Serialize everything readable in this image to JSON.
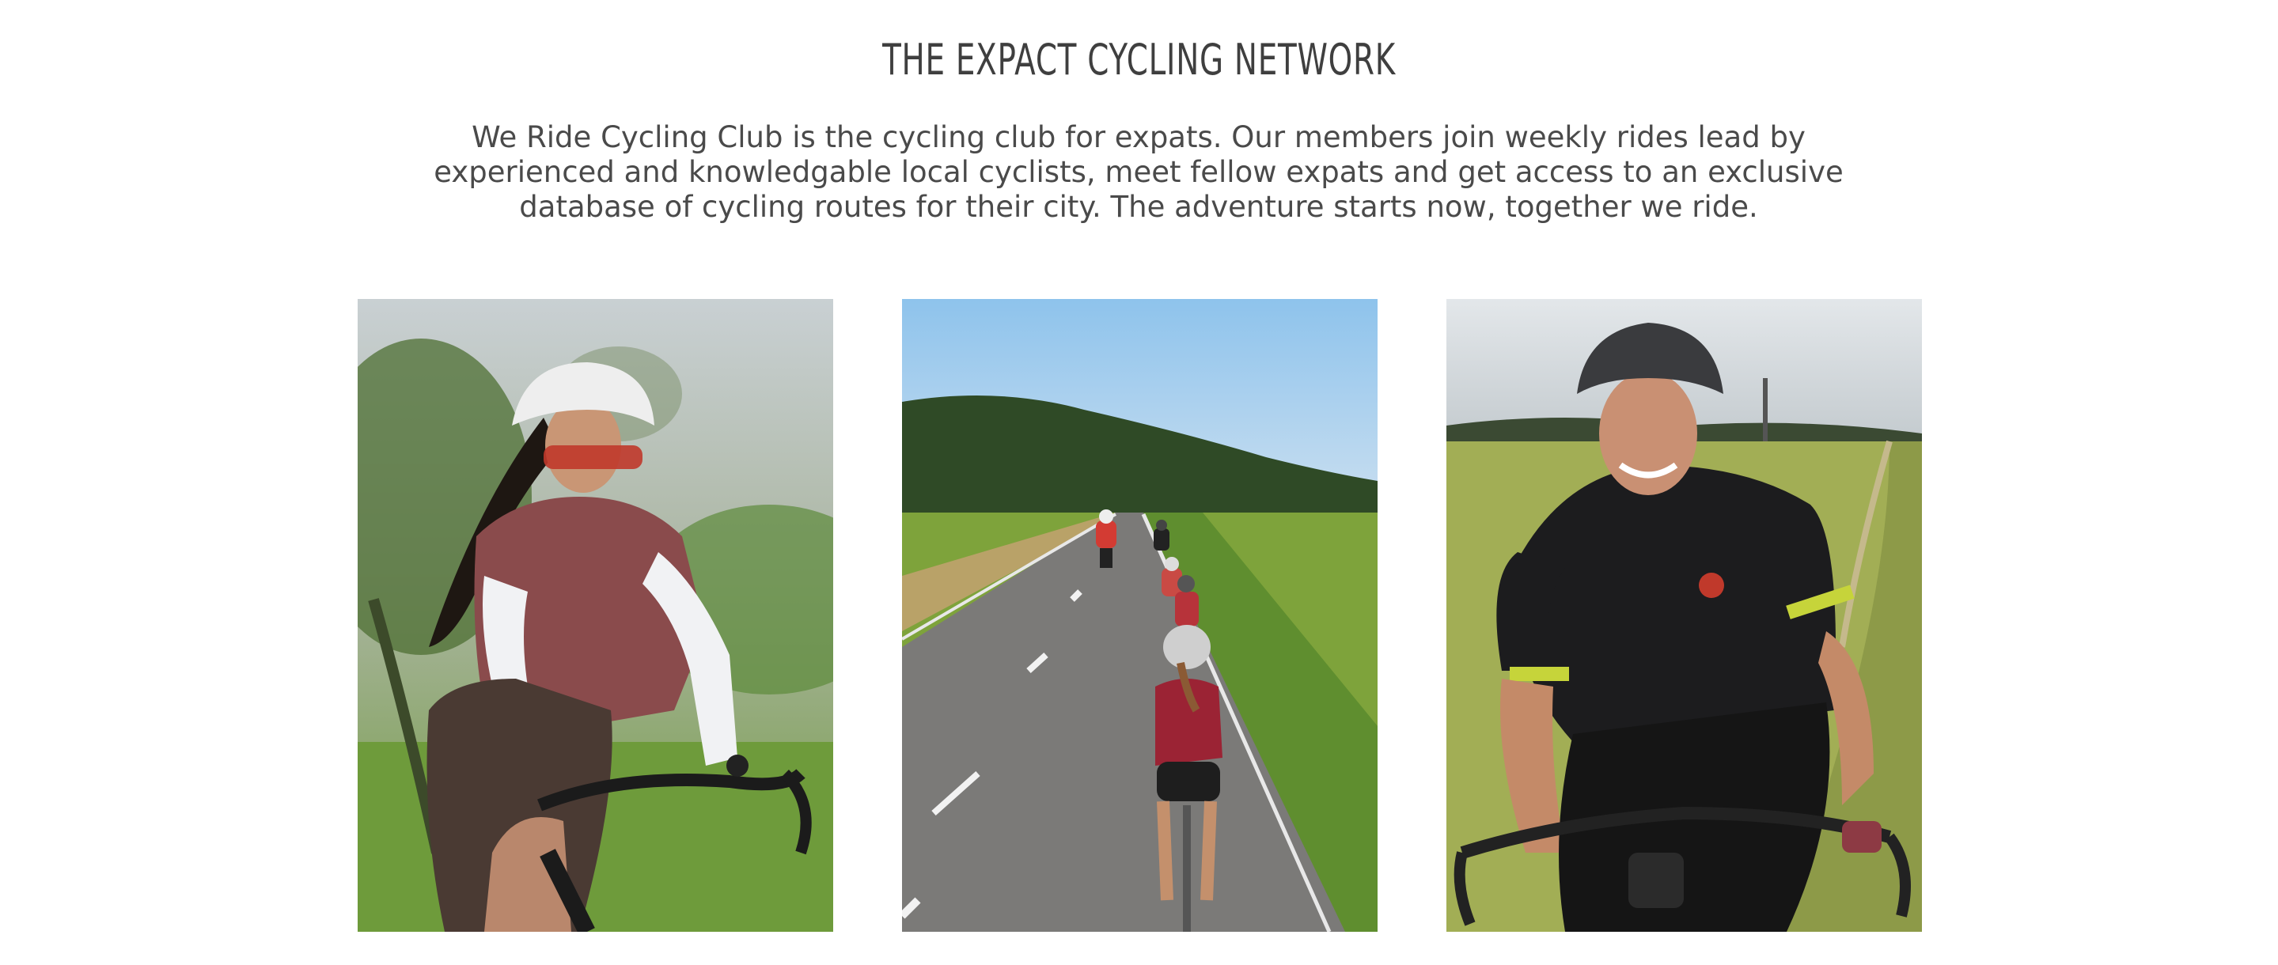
{
  "section": {
    "heading": "THE EXPACT CYCLING NETWORK",
    "intro": "We Ride Cycling Club is the cycling club for expats. Our members join weekly rides lead by experienced and knowledgable local cyclists, meet fellow expats and get access to an exclusive database of cycling routes for their city. The adventure starts now, together we ride."
  },
  "photos": [
    {
      "subject": "woman-cyclist-portrait-icon"
    },
    {
      "subject": "group-ride-road-icon"
    },
    {
      "subject": "man-cyclist-portrait-icon"
    }
  ],
  "colors": {
    "text": "#3f3f3f",
    "background": "#ffffff"
  }
}
